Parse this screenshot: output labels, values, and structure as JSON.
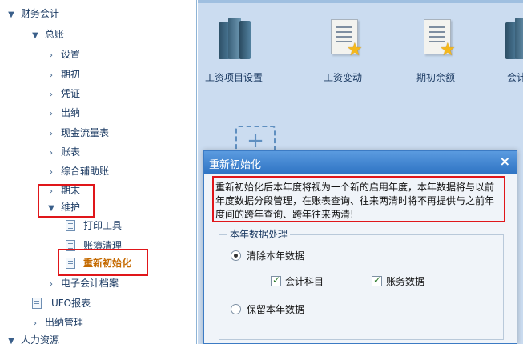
{
  "tree": {
    "items": [
      {
        "label": "财务会计",
        "arrow": "▼"
      },
      {
        "label": "总账",
        "arrow": "▼"
      },
      {
        "label": "设置",
        "arrow": "›"
      },
      {
        "label": "期初",
        "arrow": "›"
      },
      {
        "label": "凭证",
        "arrow": "›"
      },
      {
        "label": "出纳",
        "arrow": "›"
      },
      {
        "label": "现金流量表",
        "arrow": "›"
      },
      {
        "label": "账表",
        "arrow": "›"
      },
      {
        "label": "综合辅助账",
        "arrow": "›"
      },
      {
        "label": "期末",
        "arrow": "›"
      },
      {
        "label": "维护",
        "arrow": "▼"
      },
      {
        "label": "打印工具"
      },
      {
        "label": "账簿清理"
      },
      {
        "label": "重新初始化"
      },
      {
        "label": "电子会计档案",
        "arrow": "›"
      },
      {
        "label": "UFO报表"
      },
      {
        "label": "出纳管理",
        "arrow": "›"
      },
      {
        "label": "人力资源",
        "arrow": "▼"
      }
    ]
  },
  "workspace": {
    "tiles": [
      {
        "label": "工资项目设置",
        "icon": "books-icon"
      },
      {
        "label": "工资变动",
        "icon": "document-star-icon"
      },
      {
        "label": "期初余额",
        "icon": "document-star-icon"
      },
      {
        "label": "会计",
        "icon": "books-icon"
      }
    ],
    "add_tile": {
      "symbol": "+"
    }
  },
  "dialog": {
    "title": "重新初始化",
    "close_symbol": "×",
    "message": "重新初始化后本年度将视为一个新的启用年度，本年数据将与以前年度数据分段管理，在账表查询、往来两清时将不再提供与之前年度间的跨年查询、跨年往来两清!",
    "group_title": "本年数据处理",
    "options": {
      "clear": {
        "label": "清除本年数据",
        "selected": true
      },
      "accounting_subjects": {
        "label": "会计科目",
        "checked": true
      },
      "account_data": {
        "label": "账务数据",
        "checked": true
      },
      "keep": {
        "label": "保留本年数据",
        "selected": false
      }
    }
  },
  "colors": {
    "highlight": "#e0161a",
    "active_item": "#c56a00",
    "title_bar": "#2f74c4",
    "workspace_bg": "#cbdcf0"
  }
}
